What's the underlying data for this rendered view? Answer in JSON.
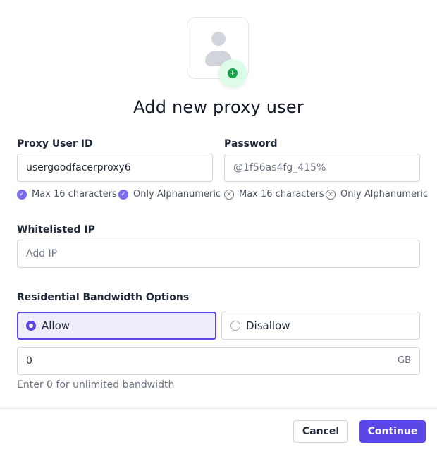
{
  "dialog": {
    "title": "Add new proxy user"
  },
  "proxy_user_id": {
    "label": "Proxy User ID",
    "value": "usergoodfacerproxy6",
    "rules": [
      {
        "text": "Max 16 characters",
        "state": "valid"
      },
      {
        "text": "Only Alphanumeric",
        "state": "valid"
      }
    ]
  },
  "password": {
    "label": "Password",
    "value": "@1f56as4fg_415%",
    "rules": [
      {
        "text": "Max 16 characters",
        "state": "invalid"
      },
      {
        "text": "Only Alphanumeric",
        "state": "invalid"
      }
    ]
  },
  "whitelisted_ip": {
    "label": "Whitelisted IP",
    "placeholder": "Add IP",
    "value": ""
  },
  "bandwidth": {
    "label": "Residential Bandwidth Options",
    "options": [
      {
        "label": "Allow",
        "selected": true
      },
      {
        "label": "Disallow",
        "selected": false
      }
    ],
    "amount": "0",
    "unit": "GB",
    "hint": "Enter 0 for unlimited bandwidth"
  },
  "footer": {
    "cancel_label": "Cancel",
    "continue_label": "Continue"
  },
  "colors": {
    "accent": "#5b46e6",
    "success": "#16a34a",
    "valid_check": "#7c6cf0"
  },
  "icons": [
    "user-avatar-icon",
    "plus-icon",
    "check-circle-icon",
    "x-circle-icon",
    "radio-icon"
  ]
}
